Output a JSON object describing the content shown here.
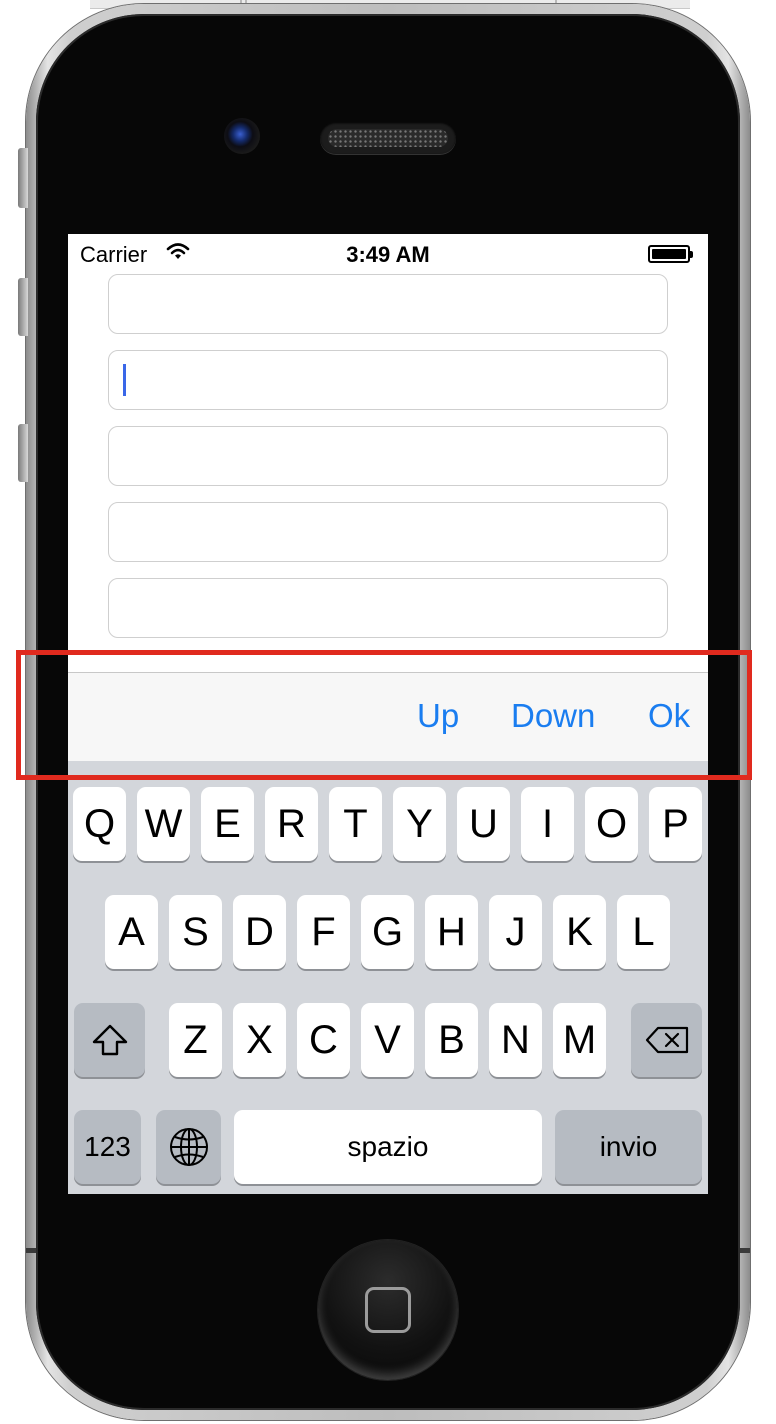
{
  "status_bar": {
    "carrier": "Carrier",
    "time": "3:49 AM"
  },
  "form": {
    "fields": [
      {
        "value": "",
        "focused": false
      },
      {
        "value": "",
        "focused": true
      },
      {
        "value": "",
        "focused": false
      },
      {
        "value": "",
        "focused": false
      },
      {
        "value": "",
        "focused": false
      }
    ]
  },
  "toolbar": {
    "up_label": "Up",
    "down_label": "Down",
    "ok_label": "Ok"
  },
  "keyboard": {
    "row1": [
      "Q",
      "W",
      "E",
      "R",
      "T",
      "Y",
      "U",
      "I",
      "O",
      "P"
    ],
    "row2": [
      "A",
      "S",
      "D",
      "F",
      "G",
      "H",
      "J",
      "K",
      "L"
    ],
    "row3": [
      "Z",
      "X",
      "C",
      "V",
      "B",
      "N",
      "M"
    ],
    "numbers_label": "123",
    "space_label": "spazio",
    "return_label": "invio"
  },
  "colors": {
    "accent": "#1a7df0",
    "cursor": "#3a67e8",
    "highlight_outline": "#e02a1e",
    "keyboard_bg": "#d3d6db"
  },
  "icons": [
    "wifi-icon",
    "battery-icon",
    "shift-icon",
    "globe-icon",
    "backspace-icon"
  ]
}
